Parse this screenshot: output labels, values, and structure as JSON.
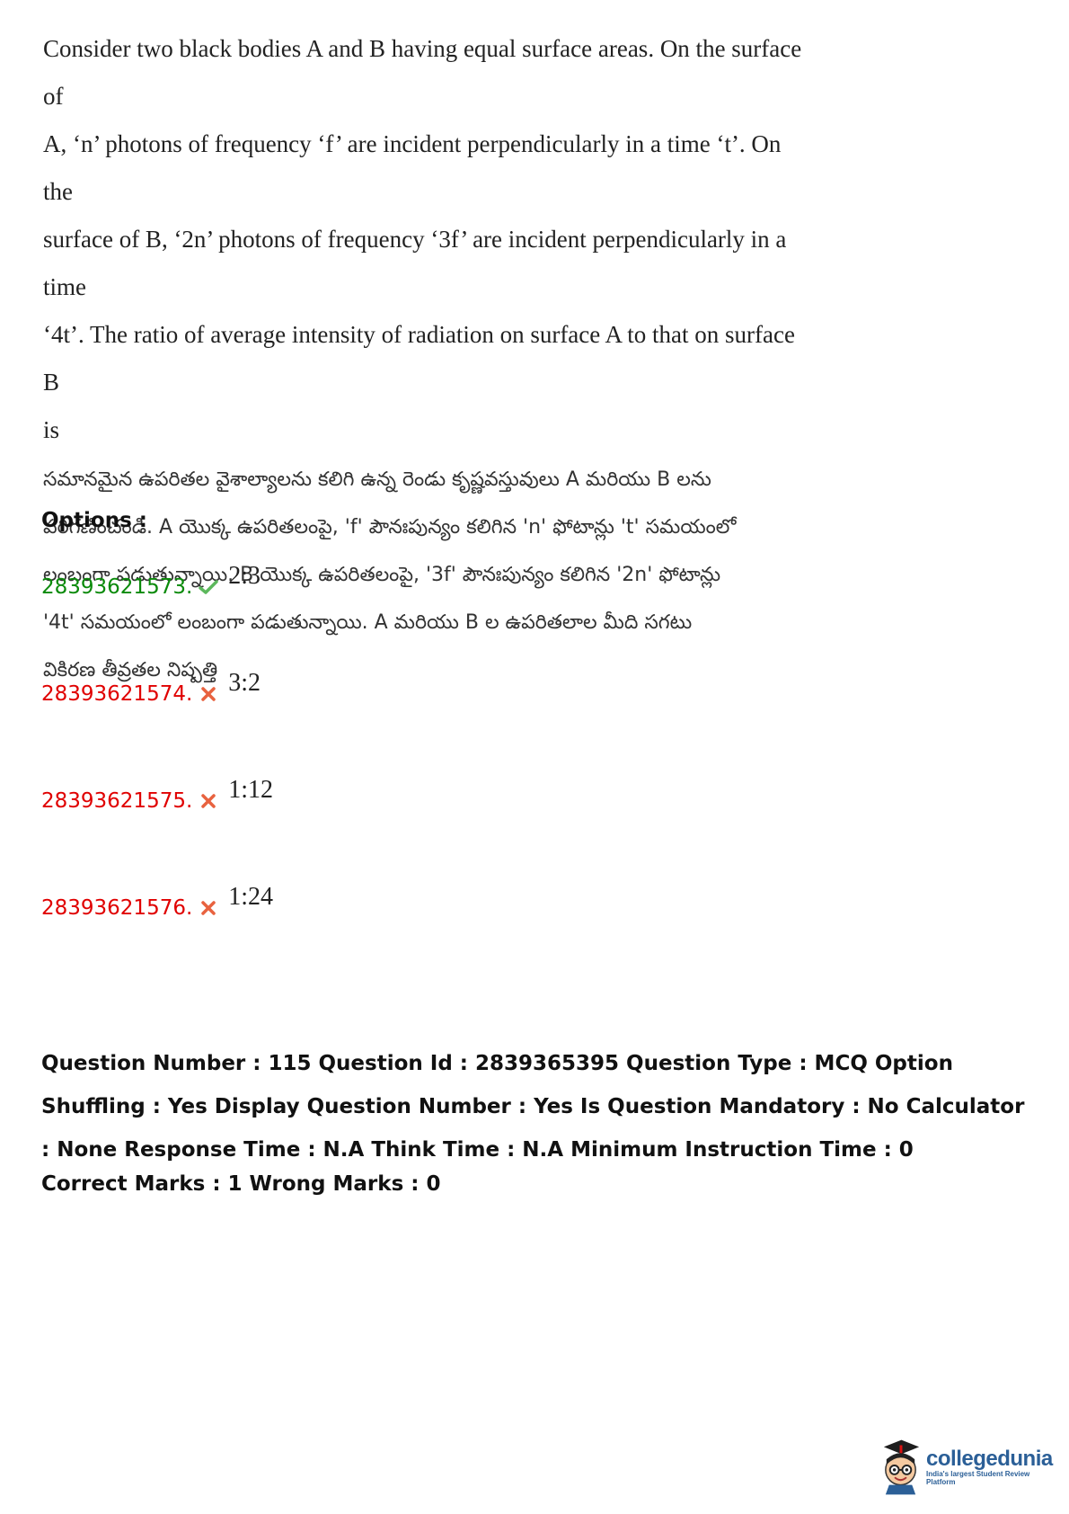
{
  "question": {
    "english_lines": [
      "Consider two black bodies A and B having equal surface areas. On the surface of",
      "A, ‘n’ photons of frequency ‘f’ are incident perpendicularly in a time ‘t’. On the",
      "surface of B, ‘2n’ photons of frequency ‘3f’ are incident perpendicularly in a time",
      "‘4t’. The ratio of average intensity of radiation on surface A to that on surface B",
      "is"
    ],
    "telugu_lines": [
      "సమానమైన ఉపరితల వైశాల్యాలను కలిగి ఉన్న రెండు కృష్ణవస్తువులు A మరియు B లను",
      "పరిగణించండి. A యొక్క ఉపరితలంపై, 'f' పౌనఃపున్యం కలిగిన 'n' ఫోటాన్లు 't' సమయంలో",
      "లంబంగా పడుతున్నాయి. B యొక్క ఉపరితలంపై, '3f' పౌనఃపున్యం కలిగిన '2n' ఫోటాన్లు",
      "'4t' సమయంలో లంబంగా పడుతున్నాయి. A మరియు B ల ఉపరితలాల మీది సగటు",
      "వికిరణ తీవ్రతల నిష్పత్తి"
    ]
  },
  "options_label": "Options :",
  "options": [
    {
      "id": "28393621573.",
      "answer": "2:3",
      "status": "correct",
      "icon": "check-icon"
    },
    {
      "id": "28393621574.",
      "answer": "3:2",
      "status": "wrong",
      "icon": "cross-icon"
    },
    {
      "id": "28393621575.",
      "answer": "1:12",
      "status": "wrong",
      "icon": "cross-icon"
    },
    {
      "id": "28393621576.",
      "answer": "1:24",
      "status": "wrong",
      "icon": "cross-icon"
    }
  ],
  "meta": {
    "details": "Question Number : 115 Question Id : 2839365395 Question Type : MCQ Option Shuffling : Yes Display Question Number : Yes Is Question Mandatory : No Calculator : None Response Time : N.A Think Time : N.A Minimum Instruction Time : 0",
    "marks": "Correct Marks : 1 Wrong Marks : 0"
  },
  "logo": {
    "name": "collegedunia",
    "tagline": "India's largest Student Review Platform"
  },
  "colors": {
    "correct": "#0a8a0a",
    "wrong": "#e00000",
    "brand": "#2b5f97"
  }
}
